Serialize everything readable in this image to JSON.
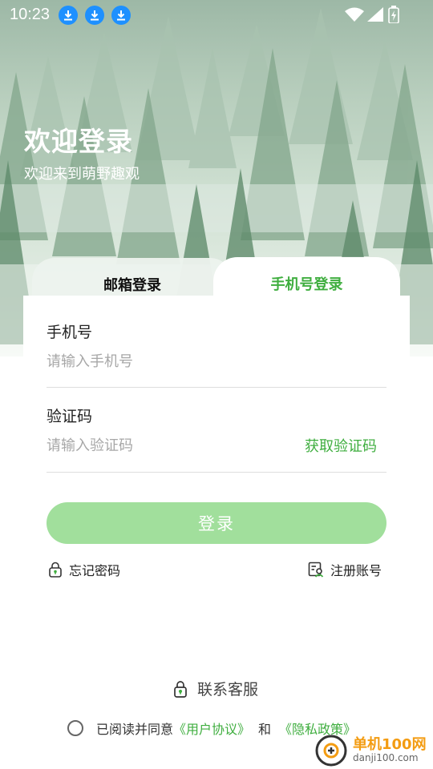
{
  "status_bar": {
    "time": "10:23"
  },
  "welcome": {
    "title": "欢迎登录",
    "subtitle": "欢迎来到萌野趣观"
  },
  "tabs": [
    {
      "label": "邮箱登录",
      "active": false
    },
    {
      "label": "手机号登录",
      "active": true
    }
  ],
  "form": {
    "phone_label": "手机号",
    "phone_placeholder": "请输入手机号",
    "code_label": "验证码",
    "code_placeholder": "请输入验证码",
    "get_code": "获取验证码",
    "login_button": "登录"
  },
  "links": {
    "forgot_password": "忘记密码",
    "register": "注册账号"
  },
  "support": {
    "label": "联系客服"
  },
  "agreement": {
    "prefix": "已阅读并同意",
    "user_agreement": "《用户协议》",
    "and": "和",
    "privacy_policy": "《隐私政策》"
  },
  "watermark": {
    "name": "单机100网",
    "url": "danji100.com"
  },
  "colors": {
    "accent": "#3fae3f",
    "button_disabled": "#a1df9c",
    "download_badge": "#1e90ff"
  },
  "icons": [
    "download-icon",
    "wifi-icon",
    "signal-icon",
    "battery-icon",
    "lock-icon",
    "id-card-icon",
    "radio-icon"
  ]
}
